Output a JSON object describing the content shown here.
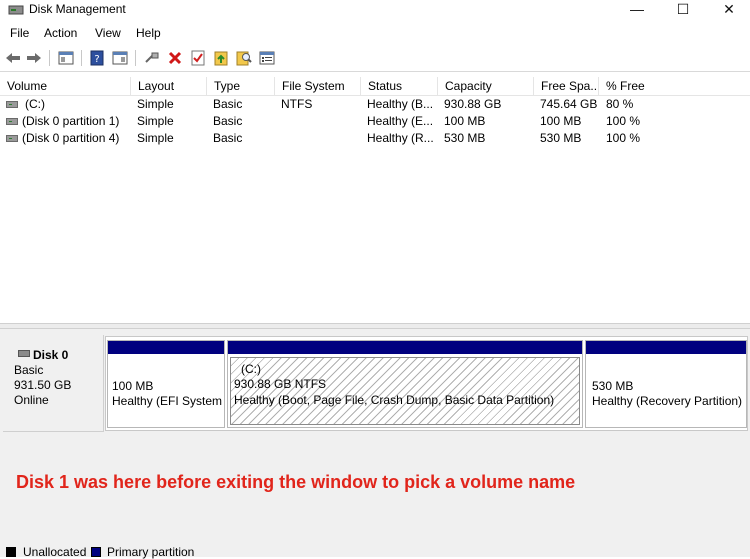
{
  "window": {
    "title": "Disk Management",
    "min": "—",
    "max": "☐",
    "close": "✕"
  },
  "menu": [
    "File",
    "Action",
    "View",
    "Help"
  ],
  "toolbar": [
    "back-icon",
    "forward-icon",
    "console-tree-icon",
    "help-icon",
    "properties-icon",
    "connect-icon",
    "delete-icon",
    "check-icon",
    "open-icon",
    "search-icon",
    "settings-icon"
  ],
  "list": {
    "columns": [
      "Volume",
      "Layout",
      "Type",
      "File System",
      "Status",
      "Capacity",
      "Free Spa...",
      "% Free"
    ],
    "rows": [
      [
        "(C:)",
        "Simple",
        "Basic",
        "NTFS",
        "Healthy (B...",
        "930.88 GB",
        "745.64 GB",
        "80 %"
      ],
      [
        "(Disk 0 partition 1)",
        "Simple",
        "Basic",
        "",
        "Healthy (E...",
        "100 MB",
        "100 MB",
        "100 %"
      ],
      [
        "(Disk 0 partition 4)",
        "Simple",
        "Basic",
        "",
        "Healthy (R...",
        "530 MB",
        "530 MB",
        "100 %"
      ]
    ]
  },
  "disk": {
    "name": "Disk 0",
    "type": "Basic",
    "size": "931.50 GB",
    "state": "Online",
    "partitions": [
      {
        "title": "",
        "size": "100 MB",
        "status": "Healthy (EFI System"
      },
      {
        "title": "(C:)",
        "size": "930.88 GB NTFS",
        "status": "Healthy (Boot, Page File, Crash Dump, Basic Data Partition)"
      },
      {
        "title": "",
        "size": "530 MB",
        "status": "Healthy (Recovery Partition)"
      }
    ]
  },
  "note": "Disk 1 was here before exiting the window to pick a volume name",
  "legend": {
    "unallocated": "Unallocated",
    "primary": "Primary partition"
  },
  "colors": {
    "primary": "#00007f",
    "unallocated": "#000000",
    "note": "#e1251b"
  }
}
